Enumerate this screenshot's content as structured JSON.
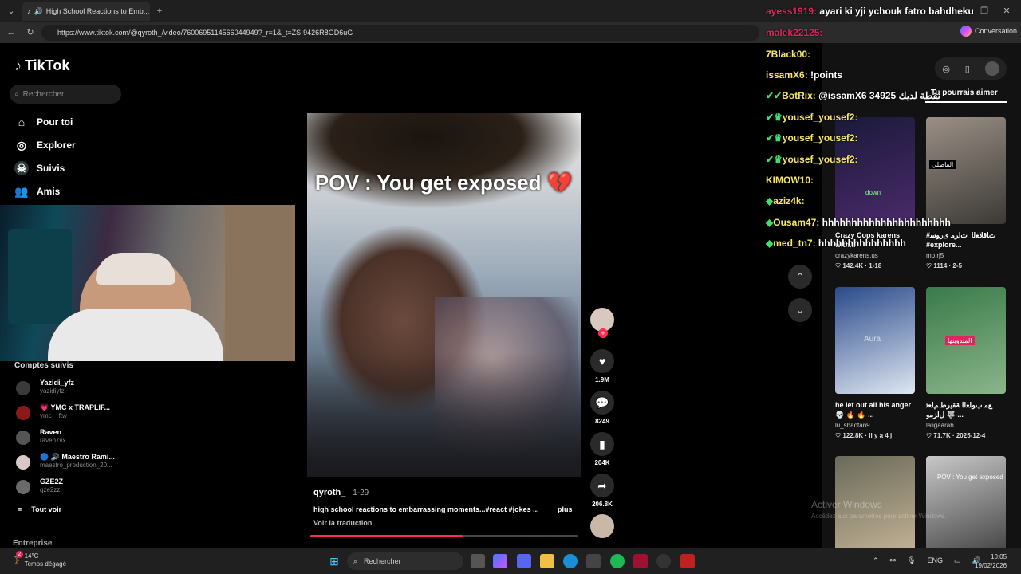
{
  "browser": {
    "tab_title": "High School Reactions to Emb...",
    "url": "https://www.tiktok.com/@qyroth_/video/7600695114566044949?_r=1&_t=ZS-9426R8GD6uG",
    "conversation_label": "Conversation"
  },
  "tiktok": {
    "logo": "TikTok",
    "search_placeholder": "Rechercher",
    "nav": [
      {
        "label": "Pour toi",
        "icon": "home-icon"
      },
      {
        "label": "Explorer",
        "icon": "compass-icon"
      },
      {
        "label": "Suivis",
        "icon": "following-icon"
      },
      {
        "label": "Amis",
        "icon": "friends-icon"
      }
    ],
    "followed_header": "Comptes suivis",
    "followed": [
      {
        "name": "Yazidi_yfz",
        "handle": "yazidiyfz",
        "color": "#3a3a3a"
      },
      {
        "name": "💗 YMC x TRAPLIF...",
        "handle": "ymc__ftw",
        "color": "#8a1a1a"
      },
      {
        "name": "Raven",
        "handle": "raven7vx",
        "color": "#555555"
      },
      {
        "name": "🔵 🔊 Maestro Rami...",
        "handle": "maestro_production_20...",
        "color": "#d9c8c8"
      },
      {
        "name": "GZE2Z",
        "handle": "gze2zz",
        "color": "#6a6a6a"
      }
    ],
    "see_all": "Tout voir",
    "entreprise": "Entreprise"
  },
  "video": {
    "overlay_text": "POV : You get exposed 💔",
    "author": "qyroth_",
    "date": " · 1-29",
    "description": "high school reactions to embarrassing moments...#react #jokes ...",
    "more": "plus",
    "translate": "Voir la traduction",
    "progress": 0.57,
    "likes": "1.9M",
    "comments": "8249",
    "saves": "204K",
    "shares": "206.8K"
  },
  "right_panel": {
    "tab": "Tu pourrais aimer",
    "cards": [
      {
        "title": "Crazy Cops \nkarens with...",
        "author": "crazykarens.us",
        "stats": "♡ 142.4K · 1-18",
        "colors": [
          "#1a1a3a",
          "#4a2a6a"
        ]
      },
      {
        "title": "#ﺕﺎﻗﻼﻌﻟﺍ_ﺕﺍﺮﻣ ﻯﺭﻮﺳ #explore...",
        "author": "mo.rj5",
        "stats": "♡ 1114 · 2-5",
        "colors": [
          "#9a8f86",
          "#3c3a36"
        ]
      },
      {
        "title": "he let out all his anger💀 🔥 🔥 ...",
        "author": "lu_shaotan9",
        "stats": "♡ 122.8K · Il y a 4 j",
        "colors": [
          "#2a4a8a",
          "#dfe6f2"
        ]
      },
      {
        "title": "ﻊﻣ ﺏﻮﻠﻌﻟﺍ ﺔﻘﻳﺮﻃ ﻢﻠﻌﺗ ﻝﺍﺰﻣﻭ 🐺 ...",
        "author": "laligaarab",
        "stats": "♡ 71.7K · 2025-12-4",
        "colors": [
          "#3a7a4a",
          "#8ab58a"
        ]
      },
      {
        "title": "",
        "author": "",
        "stats": "",
        "colors": [
          "#6a6a5a",
          "#c9b89a"
        ]
      },
      {
        "title": "",
        "author": "",
        "stats": "",
        "colors": [
          "#c8c8c8",
          "#3a3a3a"
        ]
      }
    ],
    "card_overlays": [
      "down",
      "الفاصلي",
      "Aura",
      "المتدوينها"
    ],
    "card_bottom_labels": [
      "POV : You get exposed"
    ]
  },
  "chat": [
    {
      "user": "ayess1919:",
      "msg": "ayari ki yji ychouk fatro bahdheku"
    },
    {
      "user": "malek22125:",
      "msg": ""
    },
    {
      "user": "7Black00:",
      "msg": ""
    },
    {
      "user": "issamX6:",
      "msg": "!points"
    },
    {
      "user": "BotRix:",
      "msg": "@issamX6 34925 نقطة لديك",
      "bot": true
    },
    {
      "user": "yousef_yousef2:",
      "msg": ""
    },
    {
      "user": "yousef_yousef2:",
      "msg": ""
    },
    {
      "user": "yousef_yousef2:",
      "msg": ""
    },
    {
      "user": "KIMOW10:",
      "msg": ""
    },
    {
      "user": "aziz4k:",
      "msg": ""
    },
    {
      "user": "Ousam47:",
      "msg": "hhhhhhhhhhhhhhhhhhhhhh"
    },
    {
      "user": "med_tn7:",
      "msg": "hhhhhhhhhhhhhhh"
    }
  ],
  "watermark": {
    "line1": "Activer Windows",
    "line2": "Accédez aux paramètres pour activer Windows."
  },
  "taskbar": {
    "temp": "14°C",
    "weather": "Temps dégagé",
    "search": "Rechercher",
    "lang": "ENG",
    "time": "10:05",
    "date": "19/02/2026",
    "weather_badge": "2"
  }
}
